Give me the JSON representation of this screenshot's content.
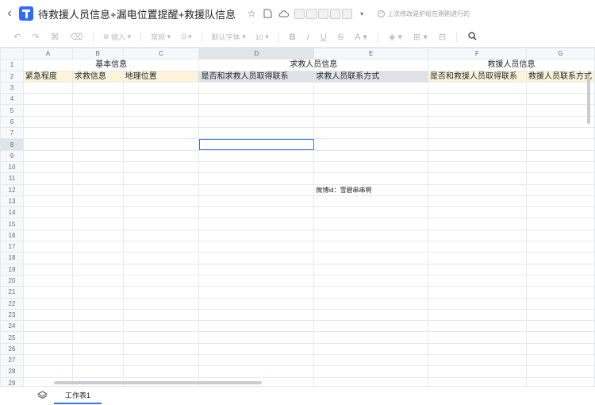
{
  "titlebar": {
    "back": "‹",
    "title": "待救援人员信息+漏电位置提醒+救援队信息",
    "save_status": "上次修改是护组在刚刚进行的"
  },
  "toolbar": {
    "insert": "插入",
    "format": "常规",
    "font": "默认字体",
    "font_size": "10",
    "bold": "B",
    "italic": "I",
    "underline": "U",
    "strike": "S",
    "text_color": "A"
  },
  "columns": [
    "A",
    "B",
    "C",
    "D",
    "E",
    "F",
    "G"
  ],
  "rows": [
    "1",
    "2",
    "3",
    "4",
    "5",
    "6",
    "7",
    "8",
    "9",
    "10",
    "11",
    "12",
    "13",
    "14",
    "15",
    "16",
    "17",
    "18",
    "19",
    "20",
    "21",
    "22",
    "23",
    "24",
    "25",
    "26",
    "27",
    "28",
    "29"
  ],
  "sheet": {
    "group_basic": "基本信息",
    "group_seeker": "求救人员信息",
    "group_rescuer": "救援人员信息",
    "h_urgency": "紧急程度",
    "h_help_info": "求救信息",
    "h_location": "地理位置",
    "h_contacted_seeker": "是否和求救人员取得联系",
    "h_seeker_contact": "求救人员联系方式",
    "h_contacted_rescuer": "是否和救援人员取得联系",
    "h_rescuer_contact": "救援人员联系方式",
    "e12": "微博id：雪碧串串啊"
  },
  "footer": {
    "sheet_tab": "工作表1"
  }
}
